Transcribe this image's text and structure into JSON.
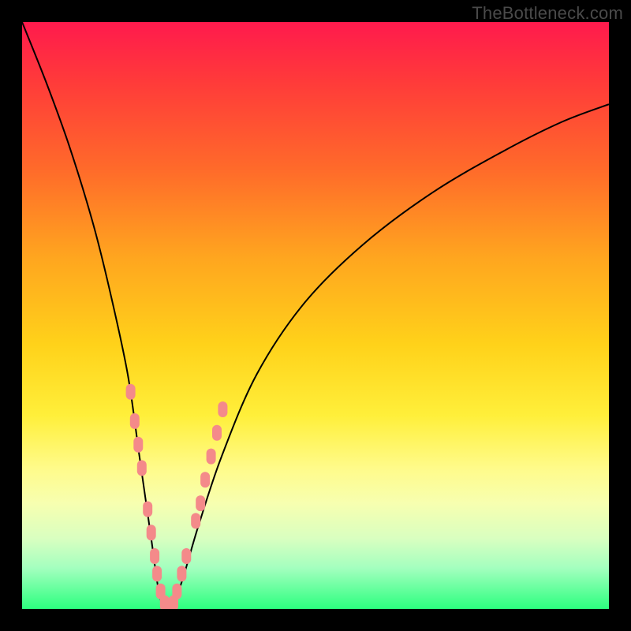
{
  "watermark": "TheBottleneck.com",
  "chart_data": {
    "type": "line",
    "title": "",
    "xlabel": "",
    "ylabel": "",
    "x_range": [
      0,
      100
    ],
    "y_range": [
      0,
      100
    ],
    "series": [
      {
        "name": "bottleneck-curve",
        "x": [
          0,
          4,
          8,
          12,
          15,
          18,
          20,
          22,
          23.5,
          25,
          27,
          30,
          34,
          40,
          48,
          58,
          70,
          82,
          92,
          100
        ],
        "y": [
          100,
          90,
          79,
          66,
          54,
          40,
          26,
          12,
          2,
          0,
          4,
          14,
          26,
          40,
          52,
          62,
          71,
          78,
          83,
          86
        ]
      }
    ],
    "scatter": {
      "name": "highlight-dots",
      "points": [
        {
          "x": 18.5,
          "y": 37
        },
        {
          "x": 19.2,
          "y": 32
        },
        {
          "x": 19.8,
          "y": 28
        },
        {
          "x": 20.4,
          "y": 24
        },
        {
          "x": 21.4,
          "y": 17
        },
        {
          "x": 22.0,
          "y": 13
        },
        {
          "x": 22.6,
          "y": 9
        },
        {
          "x": 23.0,
          "y": 6
        },
        {
          "x": 23.6,
          "y": 3
        },
        {
          "x": 24.3,
          "y": 1
        },
        {
          "x": 25.0,
          "y": 0
        },
        {
          "x": 25.8,
          "y": 1
        },
        {
          "x": 26.4,
          "y": 3
        },
        {
          "x": 27.2,
          "y": 6
        },
        {
          "x": 28.0,
          "y": 9
        },
        {
          "x": 29.6,
          "y": 15
        },
        {
          "x": 30.4,
          "y": 18
        },
        {
          "x": 31.2,
          "y": 22
        },
        {
          "x": 32.2,
          "y": 26
        },
        {
          "x": 33.2,
          "y": 30
        },
        {
          "x": 34.2,
          "y": 34
        }
      ]
    },
    "gradient_stops": [
      {
        "pos": 0,
        "color": "#ff1a4d"
      },
      {
        "pos": 10,
        "color": "#ff3a3a"
      },
      {
        "pos": 25,
        "color": "#ff6a2a"
      },
      {
        "pos": 40,
        "color": "#ffa51f"
      },
      {
        "pos": 55,
        "color": "#ffd21a"
      },
      {
        "pos": 67,
        "color": "#ffef3a"
      },
      {
        "pos": 76,
        "color": "#fffb8a"
      },
      {
        "pos": 82,
        "color": "#f7ffb0"
      },
      {
        "pos": 88,
        "color": "#d9ffc0"
      },
      {
        "pos": 93,
        "color": "#a4ffbf"
      },
      {
        "pos": 100,
        "color": "#2cff7f"
      }
    ]
  }
}
